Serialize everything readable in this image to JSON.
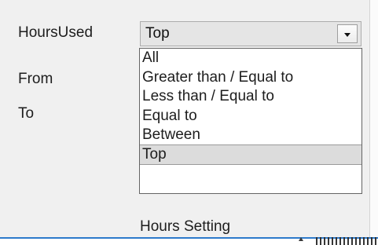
{
  "form": {
    "hours_used_label": "HoursUsed",
    "from_label": "From",
    "to_label": "To",
    "hours_setting_label": "Hours Setting"
  },
  "combo": {
    "selected": "Top",
    "button_icon": "chevron-down-icon"
  },
  "dropdown": {
    "options": [
      "All",
      "Greater than / Equal to",
      "Less than / Equal to",
      "Equal to",
      "Between",
      "Top"
    ],
    "highlighted": "Top"
  },
  "colors": {
    "panel_background": "#f0f0f0",
    "combo_background": "#e5e5e5",
    "selection_background": "#dcdcdc",
    "accent": "#2d7acb",
    "text": "#1d1d1d"
  }
}
